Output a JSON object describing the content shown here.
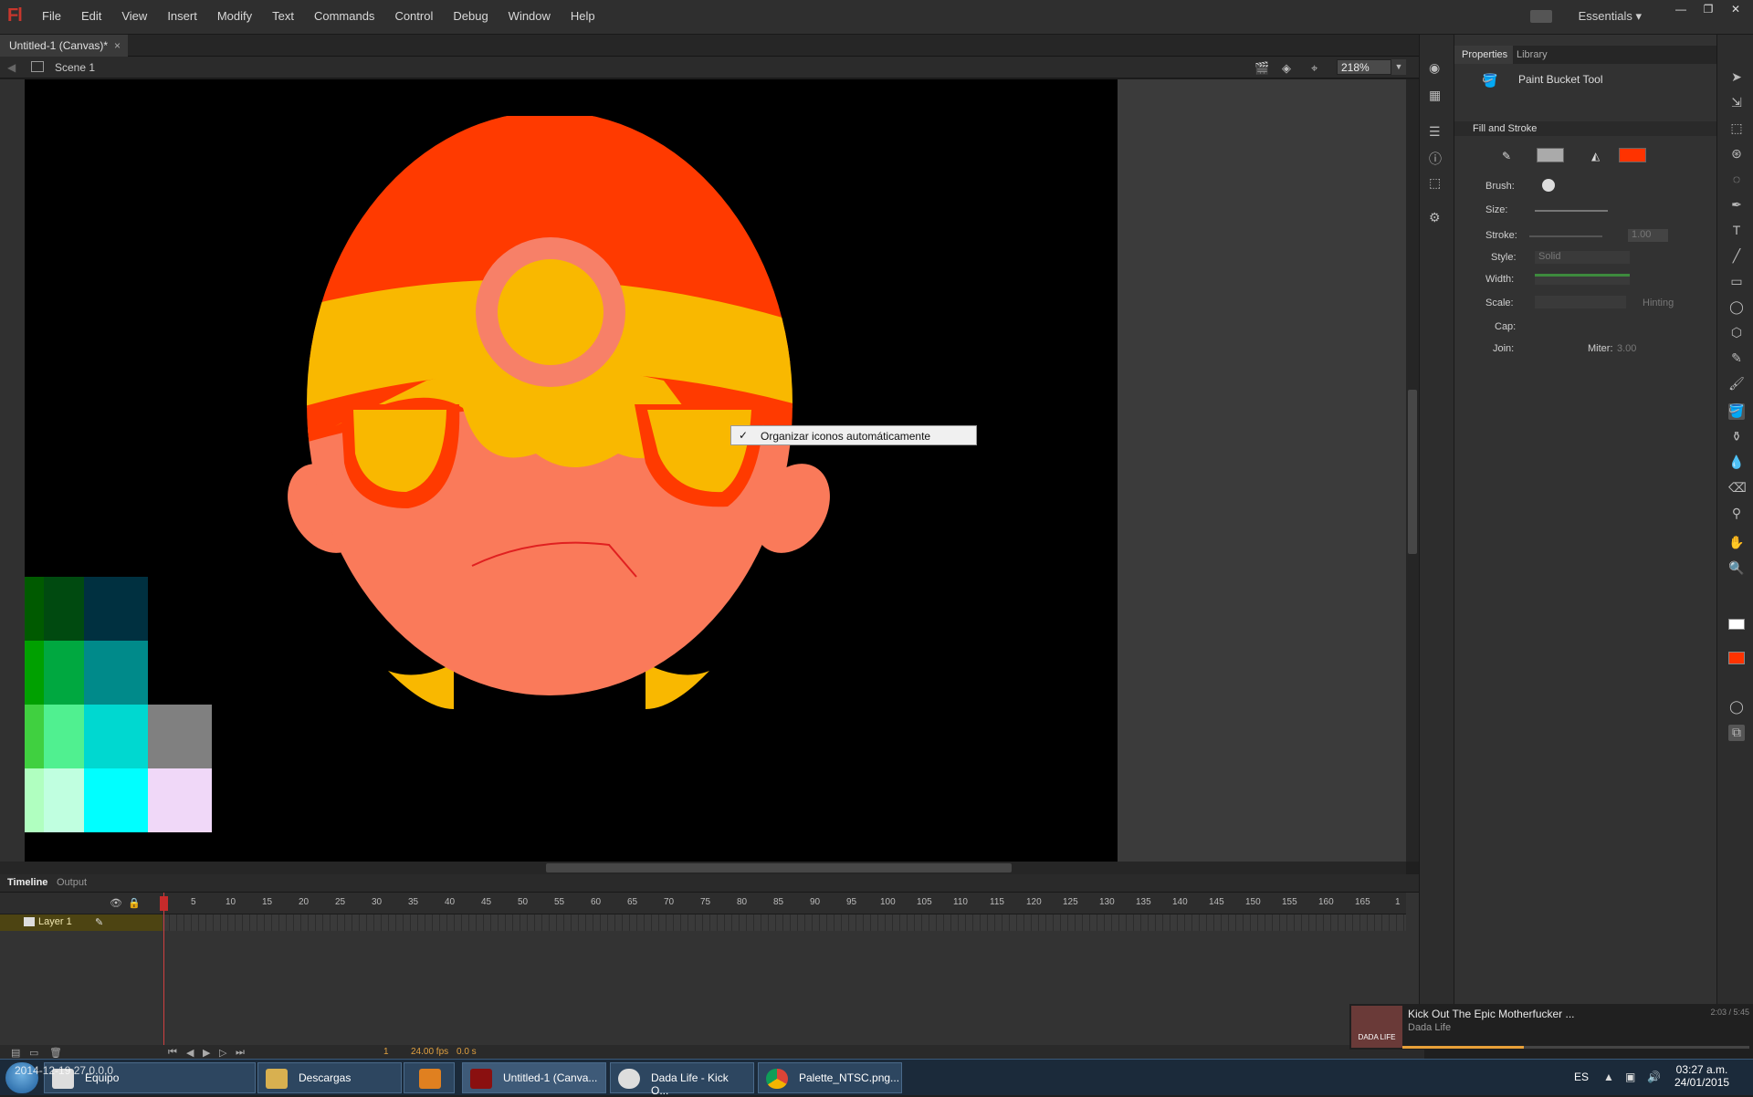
{
  "app": {
    "logo": "Fl",
    "workspace": "Essentials"
  },
  "menu": [
    "File",
    "Edit",
    "View",
    "Insert",
    "Modify",
    "Text",
    "Commands",
    "Control",
    "Debug",
    "Window",
    "Help"
  ],
  "document_tab": {
    "title": "Untitled-1 (Canvas)*",
    "close": "×"
  },
  "editbar": {
    "scene": "Scene 1",
    "zoom": "218%"
  },
  "context_menu": {
    "check": "✓",
    "label": "Organizar iconos automáticamente"
  },
  "timeline": {
    "tabs": [
      "Timeline",
      "Output"
    ],
    "layer_name": "Layer 1",
    "ruler": [
      "1",
      "5",
      "10",
      "15",
      "20",
      "25",
      "30",
      "35",
      "40",
      "45",
      "50",
      "55",
      "60",
      "65",
      "70",
      "75",
      "80",
      "85",
      "90",
      "95",
      "100",
      "105",
      "110",
      "115",
      "120",
      "125",
      "130",
      "135",
      "140",
      "145",
      "150",
      "155",
      "160",
      "165",
      "1"
    ],
    "current_frame": "1",
    "fps": "24.00 fps",
    "elapsed": "0.0 s"
  },
  "properties": {
    "tabs": [
      "Properties",
      "Library"
    ],
    "tool_name": "Paint Bucket Tool",
    "section": "Fill and Stroke",
    "labels": {
      "brush": "Brush:",
      "size": "Size:",
      "stroke": "Stroke:",
      "style": "Style:",
      "width": "Width:",
      "scale": "Scale:",
      "cap": "Cap:",
      "join": "Join:",
      "miter": "Miter:"
    },
    "values": {
      "stroke": "1.00",
      "style": "Solid",
      "hinting": "Hinting",
      "miter": "3.00"
    },
    "fill_color": "#ff3300"
  },
  "now_playing": {
    "title": "Kick Out The Epic Motherfucker ...",
    "artist": "Dada Life",
    "time": "2:03 / 5:45",
    "art_text": "DADA LIFE",
    "progress": 0.35
  },
  "taskbar": {
    "stamp": "2014-12-19 27.0.0.0",
    "buttons": [
      "Equipo",
      "Descargas",
      "",
      "Untitled-1 (Canva...",
      "Dada Life - Kick O...",
      "Palette_NTSC.png..."
    ],
    "lang": "ES",
    "time": "03:27 a.m.",
    "date": "24/01/2015"
  },
  "colors": {
    "hat_red": "#ff3a00",
    "band_yellow": "#f9b800",
    "skin": "#fa7a5a",
    "lens": "#f9b800",
    "accent_pink": "#f78068"
  }
}
